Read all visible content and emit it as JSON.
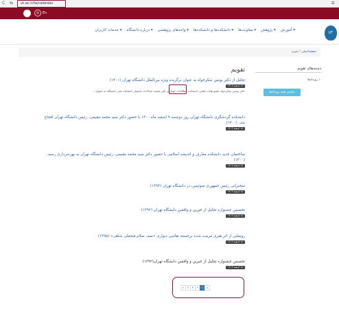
{
  "browser": {
    "back_icon": "chevron-left-icon",
    "url": "ut.ac.ir/fa/calendar"
  },
  "topbar": {
    "lang_label": "En"
  },
  "nav": {
    "items": [
      "آموزش",
      "پژوهش",
      "معاونت‌ها",
      "دانشکده‌ها و دانشکده‌ها",
      "واحدهای پژوهشی",
      "درباره دانشگاه",
      "خدمات کاربران"
    ],
    "logo_text": "UT"
  },
  "breadcrumb": {
    "home": "صفحه‌اصلی",
    "sep": " / ",
    "current": "تقویم"
  },
  "sidebar": {
    "title": "دسته‌های تقویم",
    "link": "۱ رویدادها",
    "all_events_button": "نمایش همه رویدادها"
  },
  "main": {
    "title": "تقویم",
    "items": [
      {
        "title": "تجلیل از دکتر یونس شکرخواه به عنوان برگزیده ویژه بین‌الملل دانشگاه تهران (۱۴۰۱)",
        "date": "۱۸ اسفند ۱۴۰۳",
        "desc": "دکتر یونس شکرخواه عضو هیات علمی دانشکده مطالعات جهان و دکتر محمد عبدالاحد دانشیار دانشکده فنی دانشگاه به عنوان ..."
      },
      {
        "title": "دانشکده گردشگری دانشگاه تهران روز دوشنبه ۹ اسفند ماه ۱۴۰۰ با حضور دکتر سید محمد مقیمی، رئیس دانشگاه تهران افتتاح شد. (۱۴۰۰)",
        "date": "۱۸ اسفند ۱۴۰۳"
      },
      {
        "title": "ساختمان جدید دانشکده معارف و اندیشه اسلامی با حضور دکتر سید محمد مقیمی، رئیس دانشگاه تهران به بهره‌برداری رسید. (۱۴۰۰)",
        "date": "۱۸ اسفند ۱۴۰۳"
      },
      {
        "title": "سخنرانی رئیس جمهوری سوئیس، در دانشگاه تهران (۱۳۹۴)",
        "date": "۱۸ اسفند ۱۴۰۳"
      },
      {
        "title": "نخستین جشنواره تجلیل از خیرین و واقفین دانشگاه تهران (۱۳۹۲)",
        "date": "۱۸ اسفند ۱۴۰۳"
      },
      {
        "title": "رونمایی از اثر هنری مرمت شده برجسته نقاشی دیواری «صف سلام فتحعلی شاهی» (۱۳۹۵)",
        "date": "۱۸ اسفند ۱۴۰۳"
      },
      {
        "title": "نخستین جشنواره تجلیل از خیرین و واقفین دانشگاه تهران(۱۳۹۲)",
        "date": "۱۸ اسفند ۱۴۰۳"
      }
    ]
  },
  "pagination": {
    "pages": [
      "«",
      "۴",
      "۳",
      "۲",
      "۱",
      "»"
    ],
    "active_index": 4
  },
  "colors": {
    "brand_red": "#8b0a24",
    "link_blue": "#2a5a9a",
    "highlight_border": "#8b1538",
    "button_cyan": "#5bc0de"
  }
}
